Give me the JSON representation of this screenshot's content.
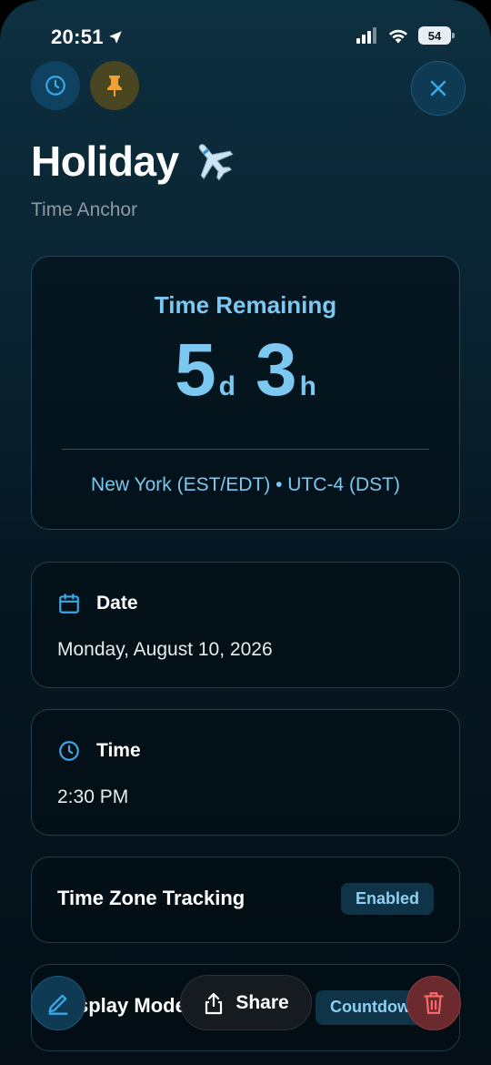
{
  "status_bar": {
    "time": "20:51",
    "battery": "54"
  },
  "header": {
    "title": "Holiday",
    "title_emoji": "✈️",
    "subtitle": "Time Anchor"
  },
  "remaining": {
    "label": "Time Remaining",
    "days": "5",
    "days_unit": "d",
    "hours": "3",
    "hours_unit": "h",
    "timezone": "New York (EST/EDT) • UTC-4 (DST)"
  },
  "date_card": {
    "label": "Date",
    "value": "Monday, August 10, 2026"
  },
  "time_card": {
    "label": "Time",
    "value": "2:30 PM"
  },
  "timezone_tracking": {
    "label": "Time Zone Tracking",
    "status": "Enabled"
  },
  "display_mode": {
    "label": "Display Mode",
    "value": "Countdown"
  },
  "actions": {
    "share": "Share"
  },
  "icons": {
    "top_left": "clock-icon",
    "top_pin": "pin-icon",
    "top_right": "close-icon",
    "date": "calendar-icon",
    "time": "clock-icon",
    "edit": "pencil-icon",
    "share": "share-icon",
    "delete": "trash-icon"
  },
  "colors": {
    "accent": "#7cc8f0",
    "pin": "#f0a030",
    "delete": "#ff6b6b"
  }
}
